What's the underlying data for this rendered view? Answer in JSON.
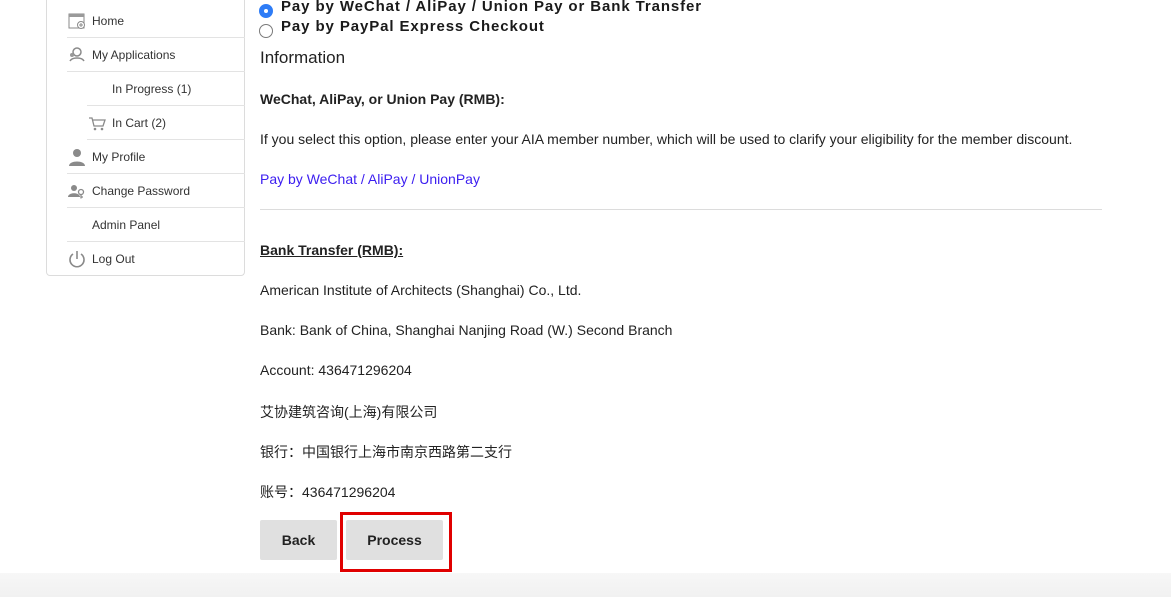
{
  "sidebar": {
    "items": [
      {
        "label": "Home",
        "icon": "home-page-icon"
      },
      {
        "label": "My Applications",
        "icon": "applications-icon"
      },
      {
        "label": "In Progress (1)",
        "icon": ""
      },
      {
        "label": "In Cart (2)",
        "icon": "cart-icon"
      },
      {
        "label": "My Profile",
        "icon": "user-icon"
      },
      {
        "label": "Change Password",
        "icon": "key-user-icon"
      },
      {
        "label": "Admin Panel",
        "icon": ""
      },
      {
        "label": "Log Out",
        "icon": "power-icon"
      }
    ]
  },
  "payment": {
    "options": [
      {
        "label": "Pay by WeChat / AliPay / Union Pay or Bank Transfer",
        "selected": true
      },
      {
        "label": "Pay by PayPal Express Checkout",
        "selected": false
      }
    ]
  },
  "info": {
    "title": "Information",
    "wechat_heading": "WeChat, AliPay, or Union Pay (RMB):",
    "wechat_text": "If you select this option, please enter your AIA member number, which will be used to clarify your eligibility for the member discount.",
    "wechat_link": "Pay by WeChat / AliPay / UnionPay",
    "bank_heading": "Bank Transfer (RMB):",
    "bank_lines": [
      "American Institute of Architects (Shanghai) Co., Ltd.",
      "Bank: Bank of China, Shanghai Nanjing Road (W.) Second Branch",
      "Account: 436471296204",
      "艾协建筑咨询(上海)有限公司",
      "银行：中国银行上海市南京西路第二支行",
      "账号：436471296204"
    ]
  },
  "buttons": {
    "back": "Back",
    "process": "Process"
  },
  "colors": {
    "link": "#3b1df0",
    "radio_selected": "#2e7cf6",
    "highlight": "#e00000",
    "button_bg": "#e0e0e0"
  }
}
